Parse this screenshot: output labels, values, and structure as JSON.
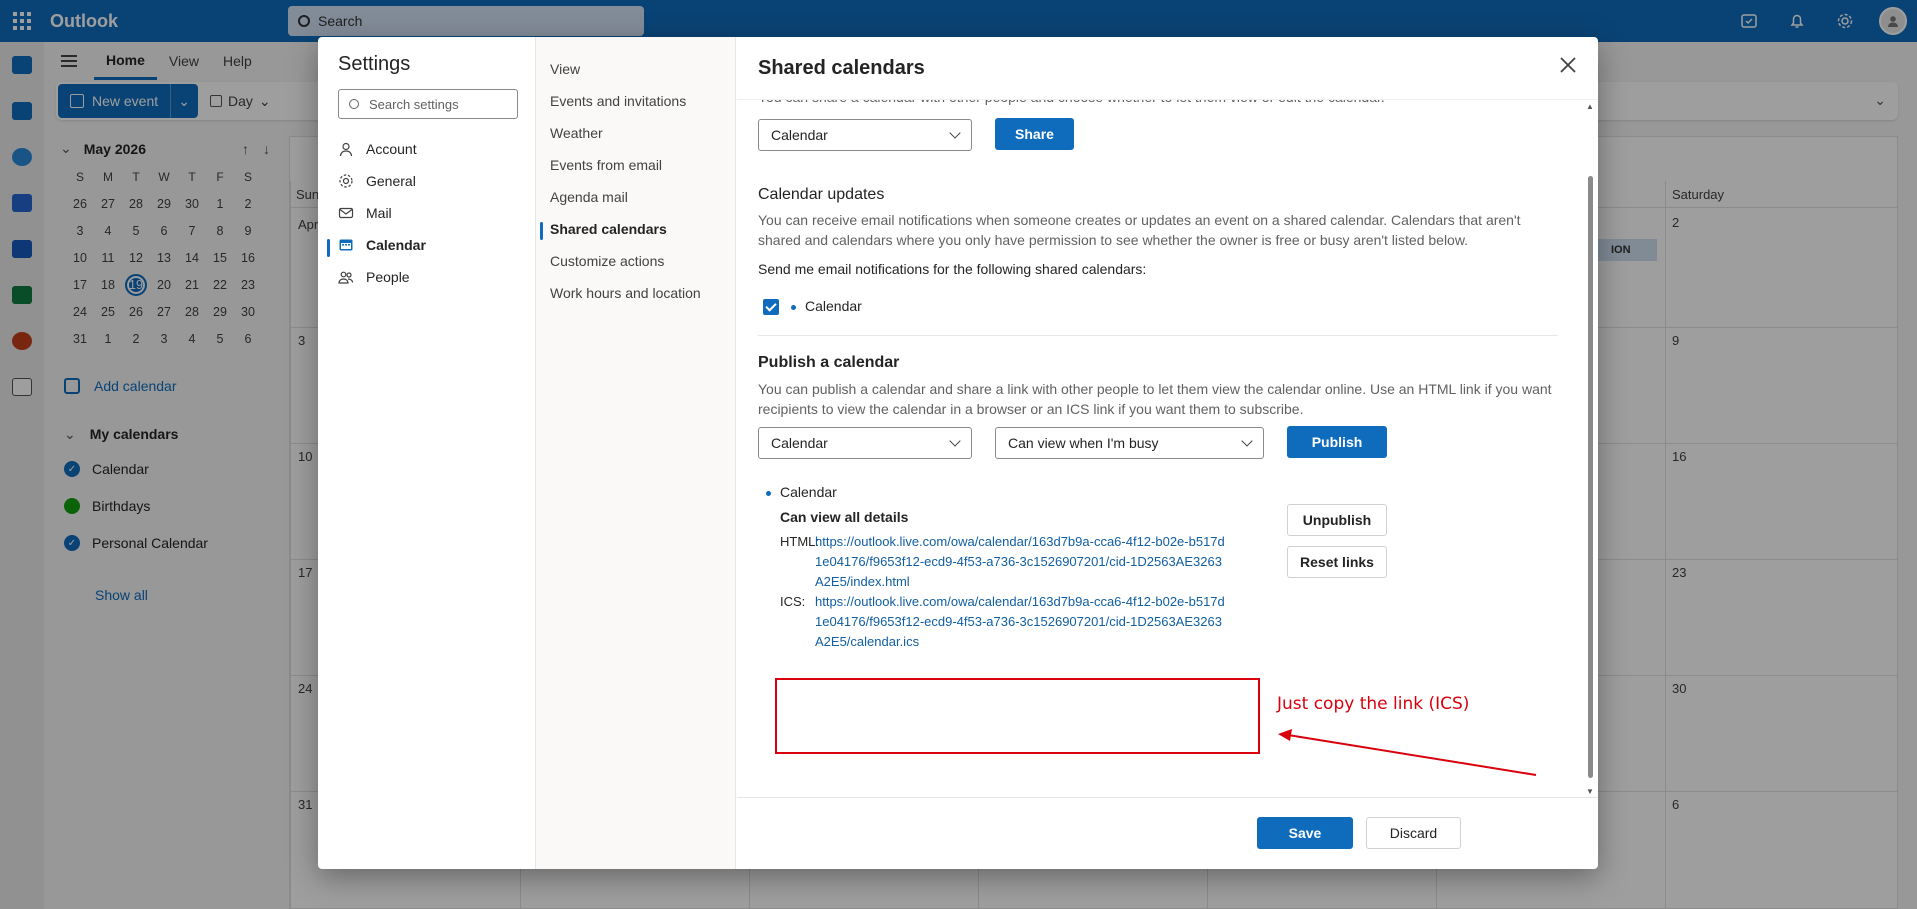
{
  "app": {
    "brand": "Outlook",
    "search_placeholder": "Search"
  },
  "ribbon": {
    "tabs": [
      "Home",
      "View",
      "Help"
    ],
    "new_event": "New event",
    "day": "Day"
  },
  "mini_calendar": {
    "month": "May 2026",
    "dow": [
      "S",
      "M",
      "T",
      "W",
      "T",
      "F",
      "S"
    ],
    "weeks": [
      [
        "26",
        "27",
        "28",
        "29",
        "30",
        "1",
        "2"
      ],
      [
        "3",
        "4",
        "5",
        "6",
        "7",
        "8",
        "9"
      ],
      [
        "10",
        "11",
        "12",
        "13",
        "14",
        "15",
        "16"
      ],
      [
        "17",
        "18",
        "19",
        "20",
        "21",
        "22",
        "23"
      ],
      [
        "24",
        "25",
        "26",
        "27",
        "28",
        "29",
        "30"
      ],
      [
        "31",
        "1",
        "2",
        "3",
        "4",
        "5",
        "6"
      ]
    ],
    "today": "19"
  },
  "sidebar": {
    "add_calendar": "Add calendar",
    "my_calendars": "My calendars",
    "calendars": [
      {
        "name": "Calendar",
        "color": "#0f6cbd"
      },
      {
        "name": "Birthdays",
        "color": "#13a10e"
      },
      {
        "name": "Personal Calendar",
        "color": "#0f6cbd"
      }
    ],
    "show_all": "Show all"
  },
  "background_calendar": {
    "col_sunday": "Sund",
    "col_saturday": "Saturday",
    "apr": "Apr",
    "sunday_dates": [
      "3",
      "10",
      "17",
      "24",
      "31"
    ],
    "saturday_dates": [
      "2",
      "9",
      "16",
      "23",
      "30",
      "6"
    ],
    "event_fragment": "ION"
  },
  "settings": {
    "title": "Settings",
    "search_placeholder": "Search settings",
    "categories": [
      "Account",
      "General",
      "Mail",
      "Calendar",
      "People"
    ],
    "active_category": "Calendar",
    "subcategories": [
      "View",
      "Events and invitations",
      "Weather",
      "Events from email",
      "Agenda mail",
      "Shared calendars",
      "Customize actions",
      "Work hours and location"
    ],
    "active_subcategory": "Shared calendars"
  },
  "pane": {
    "title": "Shared calendars",
    "share_intro_cut": "You can share a calendar with other people and choose whether to let them view or edit the calendar.",
    "share_calendar_select": "Calendar",
    "share_button": "Share",
    "updates_title": "Calendar updates",
    "updates_desc": "You can receive email notifications when someone creates or updates an event on a shared calendar. Calendars that aren't shared and calendars where you only have permission to see whether the owner is free or busy aren't listed below.",
    "updates_prompt": "Send me email notifications for the following shared calendars:",
    "updates_item": "Calendar",
    "publish_title": "Publish a calendar",
    "publish_desc": "You can publish a calendar and share a link with other people to let them view the calendar online. Use an HTML link if you want recipients to view the calendar in a browser or an ICS link if you want them to subscribe.",
    "publish_calendar_select": "Calendar",
    "publish_permission_select": "Can view when I'm busy",
    "publish_button": "Publish",
    "published_calendar": "Calendar",
    "published_permission": "Can view all details",
    "html_label": "HTML:",
    "html_link": "https://outlook.live.com/owa/calendar/163d7b9a-cca6-4f12-b02e-b517d1e04176/f9653f12-ecd9-4f53-a736-3c1526907201/cid-1D2563AE3263A2E5/index.html",
    "ics_label": "ICS:",
    "ics_link": "https://outlook.live.com/owa/calendar/163d7b9a-cca6-4f12-b02e-b517d1e04176/f9653f12-ecd9-4f53-a736-3c1526907201/cid-1D2563AE3263A2E5/calendar.ics",
    "unpublish_button": "Unpublish",
    "reset_links_button": "Reset links",
    "save_button": "Save",
    "discard_button": "Discard"
  },
  "annotation": {
    "text": "Just copy the link (ICS)",
    "color": "#d9000d"
  }
}
